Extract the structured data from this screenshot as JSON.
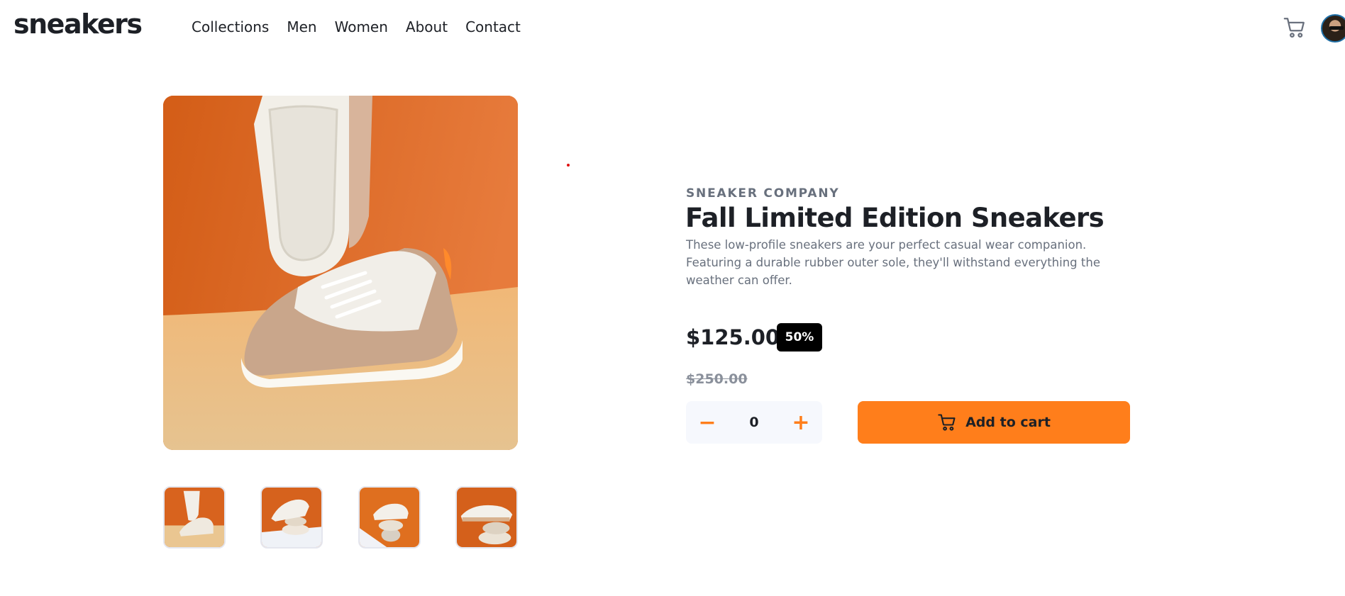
{
  "header": {
    "logo": "sneakers",
    "nav": [
      "Collections",
      "Men",
      "Women",
      "About",
      "Contact"
    ],
    "cart_icon": "cart-icon",
    "avatar_icon": "avatar"
  },
  "gallery": {
    "main_image": "sneaker-main-image",
    "thumbnails": [
      "thumbnail-1",
      "thumbnail-2",
      "thumbnail-3",
      "thumbnail-4"
    ]
  },
  "product": {
    "company": "SNEAKER COMPANY",
    "title": "Fall Limited Edition Sneakers",
    "description": "These low-profile sneakers are your perfect casual wear companion. Featuring a durable rubber outer sole, they'll withstand everything the weather can offer.",
    "price": "$125.00",
    "discount": "50%",
    "original_price": "$250.00",
    "quantity": "0",
    "minus_symbol": "−",
    "plus_symbol": "+",
    "add_to_cart_label": "Add to cart"
  },
  "colors": {
    "accent": "#ff7e1b",
    "dark": "#1d2026",
    "muted": "#68707d",
    "badge_bg": "#000000",
    "qty_bg": "#f6f8fd"
  }
}
